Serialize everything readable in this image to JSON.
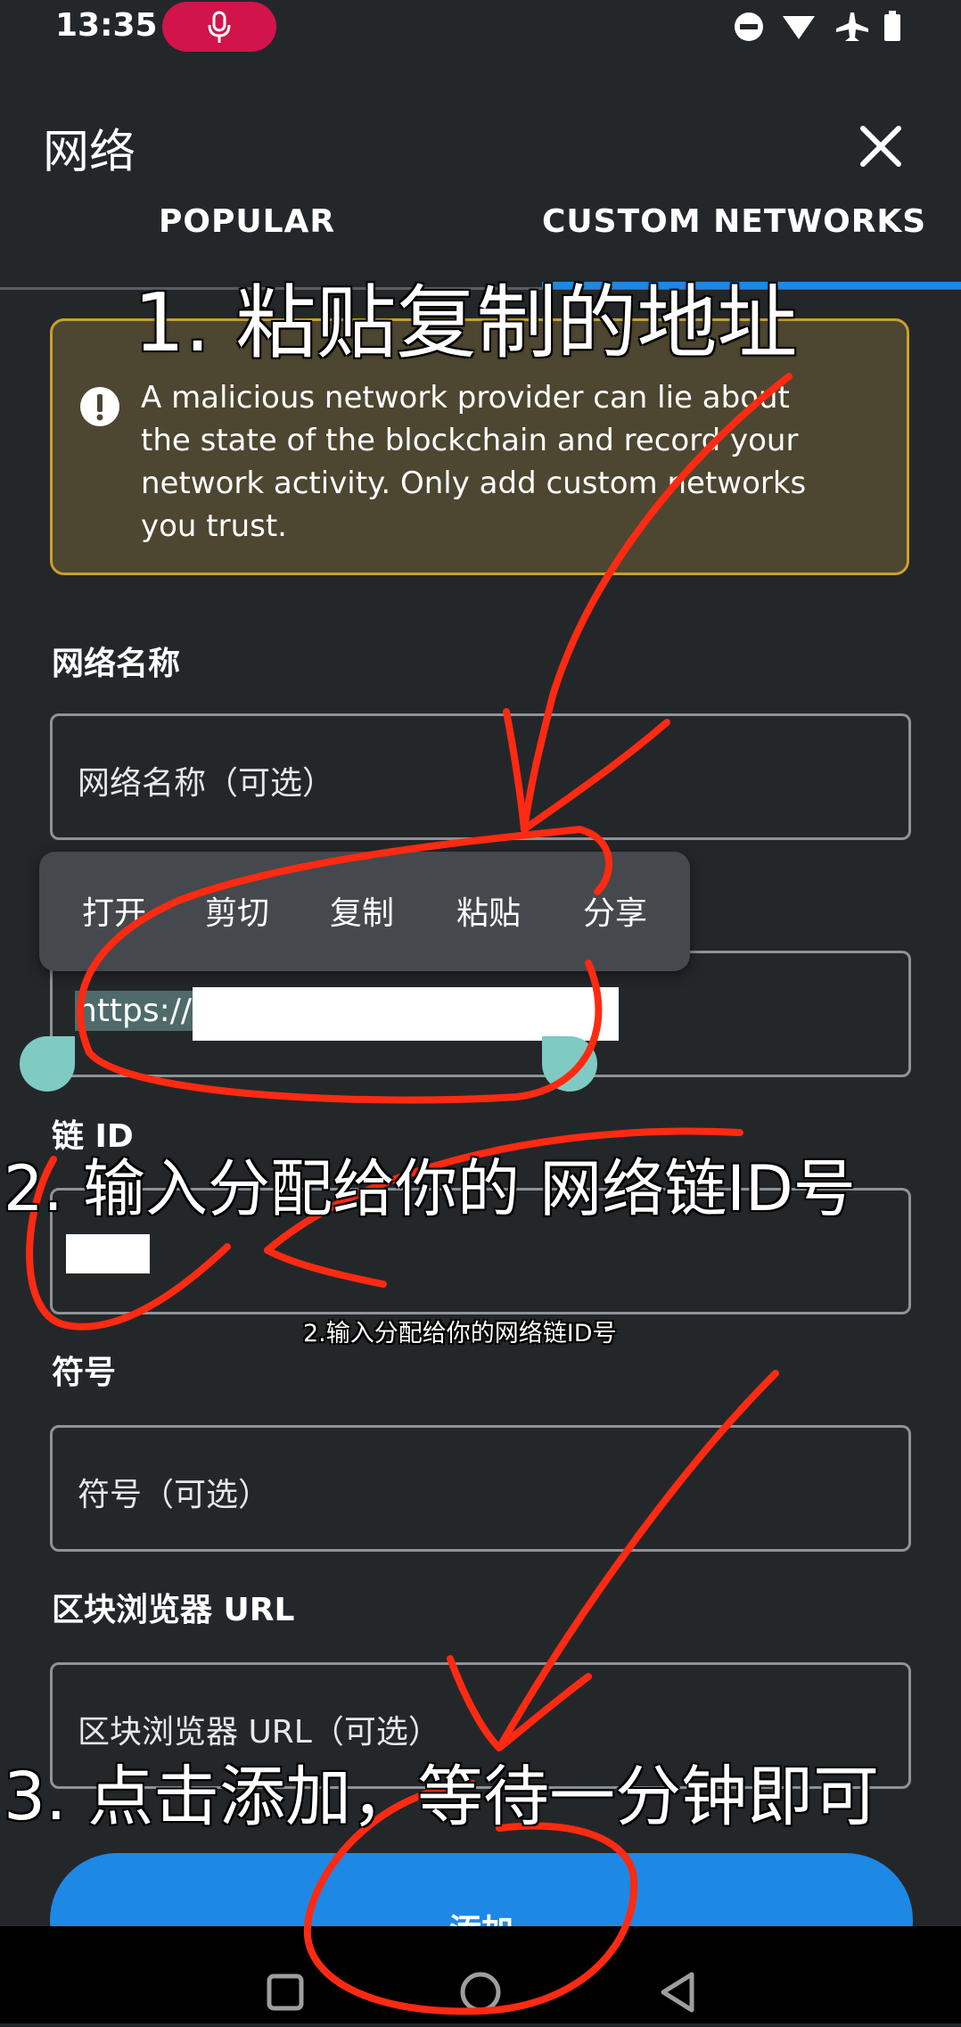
{
  "status_bar": {
    "time": "13:35"
  },
  "header": {
    "title": "网络"
  },
  "tabs": [
    {
      "label": "POPULAR",
      "active": false
    },
    {
      "label": "CUSTOM NETWORKS",
      "active": true
    }
  ],
  "warning": {
    "text": "A malicious network provider can lie about the state of the blockchain and record your network activity. Only add custom networks you trust."
  },
  "form": {
    "network_name": {
      "label": "网络名称",
      "placeholder": "网络名称（可选）"
    },
    "rpc_url": {
      "value_prefix": "https://"
    },
    "chain_id": {
      "label": "链 ID"
    },
    "symbol": {
      "label": "符号",
      "placeholder": "符号（可选）"
    },
    "block_explorer": {
      "label": "区块浏览器 URL",
      "placeholder": "区块浏览器 URL（可选）"
    },
    "add_button": "添加"
  },
  "context_menu": [
    "打开",
    "剪切",
    "复制",
    "粘贴",
    "分享"
  ],
  "annotations": {
    "step1": "1. 粘贴复制的地址",
    "step2": "2.  输入分配给你的 网络链ID号",
    "step2_small": "2.输入分配给你的网络链ID号",
    "step3": "3. 点击添加，等待一分钟即可"
  },
  "colors": {
    "background": "#24272a",
    "accent": "#1e88e5",
    "warning_border": "#c9a02a",
    "annotation_stroke": "#ff2a12"
  }
}
